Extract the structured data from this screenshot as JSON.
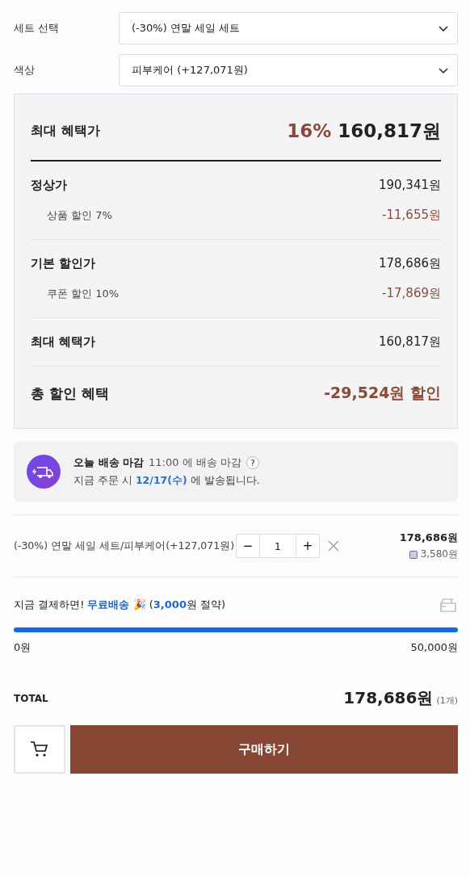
{
  "options": [
    {
      "label": "세트 선택",
      "value": "(-30%) 연말 세일 세트"
    },
    {
      "label": "색상",
      "value": "피부케어 (+127,071원)"
    }
  ],
  "benefit": {
    "title": "최대 혜택가",
    "rate": "16%",
    "price": "160,817원",
    "rows": [
      {
        "kind": "main",
        "label": "정상가",
        "value": "190,341원"
      },
      {
        "kind": "sub",
        "label": "상품 할인 7%",
        "value": "-11,655원"
      },
      {
        "kind": "main",
        "label": "기본 할인가",
        "value": "178,686원"
      },
      {
        "kind": "sub",
        "label": "쿠폰 할인 10%",
        "value": "-17,869원"
      },
      {
        "kind": "main",
        "label": "최대 혜택가",
        "value": "160,817원"
      },
      {
        "kind": "total",
        "label": "총 할인 혜택",
        "value": "-29,524원 할인"
      }
    ]
  },
  "delivery": {
    "title": "오늘 배송 마감",
    "deadline": "11:00 에 배송 마감",
    "help": "?",
    "message": "지금 주문 시 **12/17(수)** 에 발송됩니다."
  },
  "cart_item": {
    "name": "(-30%) 연말 세일 세트/피부케어(+127,071원)",
    "minus": "−",
    "quantity": "1",
    "plus": "+",
    "price": "178,686원",
    "points": "3,580원"
  },
  "free_shipping": {
    "message": "지금 결제하면! **무료배송** 🎉 (**3,000**원 절약)",
    "level": 1,
    "min": "0원",
    "max": "50,000원"
  },
  "total": {
    "label": "TOTAL",
    "price": "178,686원",
    "count": "(1개)"
  },
  "buy_button": "구매하기"
}
